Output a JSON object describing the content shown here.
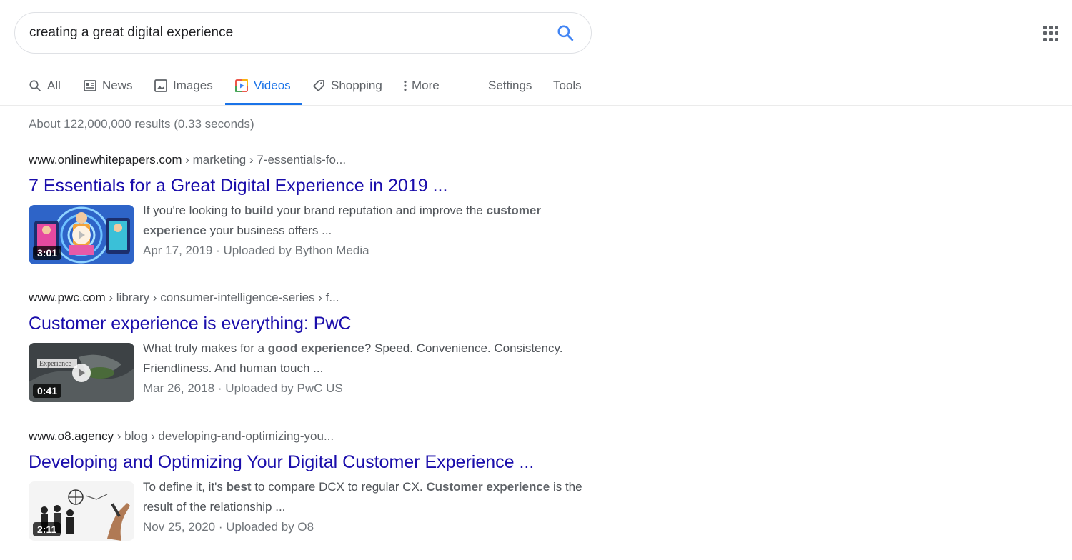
{
  "search": {
    "query": "creating a great digital experience",
    "button_icon": "search-icon"
  },
  "apps": {
    "icon": "apps-grid-icon"
  },
  "tabs": [
    {
      "label": "All",
      "icon": "search-icon"
    },
    {
      "label": "News",
      "icon": "news-icon"
    },
    {
      "label": "Images",
      "icon": "image-icon"
    },
    {
      "label": "Videos",
      "icon": "video-icon",
      "active": true
    },
    {
      "label": "Shopping",
      "icon": "tag-icon"
    },
    {
      "label": "More",
      "icon": "more-vert-icon"
    },
    {
      "label": "Settings"
    },
    {
      "label": "Tools"
    }
  ],
  "stats": "About 122,000,000 results (0.33 seconds)",
  "results": [
    {
      "domain": "www.onlinewhitepapers.com",
      "path": " › marketing › 7-essentials-fo...",
      "title": "7 Essentials for a Great Digital Experience in 2019 ...",
      "snippet_parts": [
        "If you're looking to ",
        "build",
        " your brand reputation and improve the ",
        "customer experience",
        " your business offers ..."
      ],
      "date": "Apr 17, 2019",
      "uploader": " · Uploaded by Bython Media",
      "duration": "3:01"
    },
    {
      "domain": "www.pwc.com",
      "path": " › library › consumer-intelligence-series › f...",
      "title": "Customer experience is everything: PwC",
      "snippet_parts": [
        "What truly makes for a ",
        "good experience",
        "? Speed. Convenience. Consistency. Friendliness. And human touch ..."
      ],
      "date": "Mar 26, 2018",
      "uploader": " · Uploaded by PwC US",
      "duration": "0:41",
      "thumb_text": "Experience"
    },
    {
      "domain": "www.o8.agency",
      "path": " › blog › developing-and-optimizing-you...",
      "title": "Developing and Optimizing Your Digital Customer Experience ...",
      "snippet_parts": [
        "To define it, it's ",
        "best",
        " to compare DCX to regular CX. ",
        "Customer experience",
        " is the result of the relationship ..."
      ],
      "date": "Nov 25, 2020",
      "uploader": " · Uploaded by O8",
      "duration": "2:11"
    }
  ],
  "colors": {
    "link": "#1a0dab",
    "accent": "#1a73e8",
    "muted": "#70757a"
  }
}
